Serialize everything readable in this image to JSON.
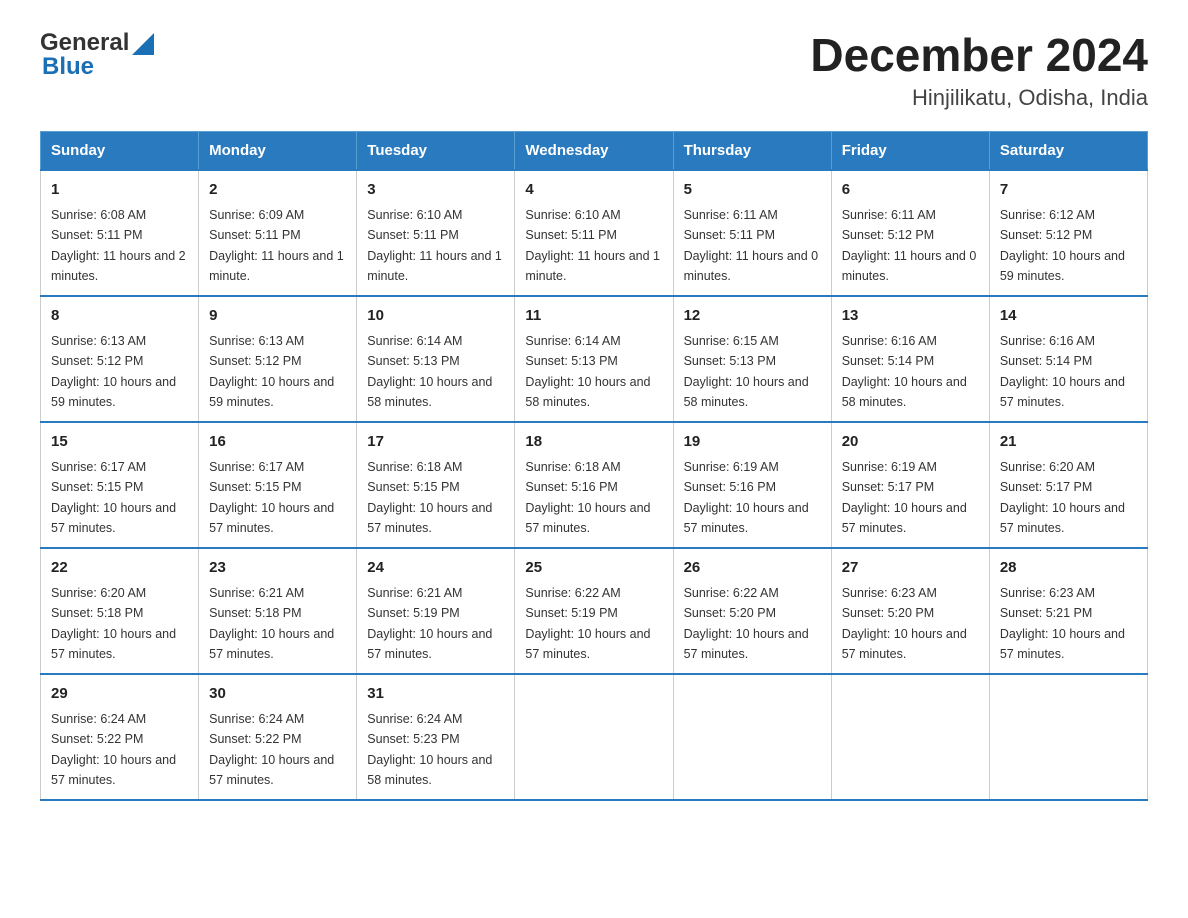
{
  "logo": {
    "text_general": "General",
    "text_blue": "Blue"
  },
  "header": {
    "month_year": "December 2024",
    "location": "Hinjilikatu, Odisha, India"
  },
  "weekdays": [
    "Sunday",
    "Monday",
    "Tuesday",
    "Wednesday",
    "Thursday",
    "Friday",
    "Saturday"
  ],
  "weeks": [
    [
      {
        "day": "1",
        "sunrise": "6:08 AM",
        "sunset": "5:11 PM",
        "daylight": "11 hours and 2 minutes."
      },
      {
        "day": "2",
        "sunrise": "6:09 AM",
        "sunset": "5:11 PM",
        "daylight": "11 hours and 1 minute."
      },
      {
        "day": "3",
        "sunrise": "6:10 AM",
        "sunset": "5:11 PM",
        "daylight": "11 hours and 1 minute."
      },
      {
        "day": "4",
        "sunrise": "6:10 AM",
        "sunset": "5:11 PM",
        "daylight": "11 hours and 1 minute."
      },
      {
        "day": "5",
        "sunrise": "6:11 AM",
        "sunset": "5:11 PM",
        "daylight": "11 hours and 0 minutes."
      },
      {
        "day": "6",
        "sunrise": "6:11 AM",
        "sunset": "5:12 PM",
        "daylight": "11 hours and 0 minutes."
      },
      {
        "day": "7",
        "sunrise": "6:12 AM",
        "sunset": "5:12 PM",
        "daylight": "10 hours and 59 minutes."
      }
    ],
    [
      {
        "day": "8",
        "sunrise": "6:13 AM",
        "sunset": "5:12 PM",
        "daylight": "10 hours and 59 minutes."
      },
      {
        "day": "9",
        "sunrise": "6:13 AM",
        "sunset": "5:12 PM",
        "daylight": "10 hours and 59 minutes."
      },
      {
        "day": "10",
        "sunrise": "6:14 AM",
        "sunset": "5:13 PM",
        "daylight": "10 hours and 58 minutes."
      },
      {
        "day": "11",
        "sunrise": "6:14 AM",
        "sunset": "5:13 PM",
        "daylight": "10 hours and 58 minutes."
      },
      {
        "day": "12",
        "sunrise": "6:15 AM",
        "sunset": "5:13 PM",
        "daylight": "10 hours and 58 minutes."
      },
      {
        "day": "13",
        "sunrise": "6:16 AM",
        "sunset": "5:14 PM",
        "daylight": "10 hours and 58 minutes."
      },
      {
        "day": "14",
        "sunrise": "6:16 AM",
        "sunset": "5:14 PM",
        "daylight": "10 hours and 57 minutes."
      }
    ],
    [
      {
        "day": "15",
        "sunrise": "6:17 AM",
        "sunset": "5:15 PM",
        "daylight": "10 hours and 57 minutes."
      },
      {
        "day": "16",
        "sunrise": "6:17 AM",
        "sunset": "5:15 PM",
        "daylight": "10 hours and 57 minutes."
      },
      {
        "day": "17",
        "sunrise": "6:18 AM",
        "sunset": "5:15 PM",
        "daylight": "10 hours and 57 minutes."
      },
      {
        "day": "18",
        "sunrise": "6:18 AM",
        "sunset": "5:16 PM",
        "daylight": "10 hours and 57 minutes."
      },
      {
        "day": "19",
        "sunrise": "6:19 AM",
        "sunset": "5:16 PM",
        "daylight": "10 hours and 57 minutes."
      },
      {
        "day": "20",
        "sunrise": "6:19 AM",
        "sunset": "5:17 PM",
        "daylight": "10 hours and 57 minutes."
      },
      {
        "day": "21",
        "sunrise": "6:20 AM",
        "sunset": "5:17 PM",
        "daylight": "10 hours and 57 minutes."
      }
    ],
    [
      {
        "day": "22",
        "sunrise": "6:20 AM",
        "sunset": "5:18 PM",
        "daylight": "10 hours and 57 minutes."
      },
      {
        "day": "23",
        "sunrise": "6:21 AM",
        "sunset": "5:18 PM",
        "daylight": "10 hours and 57 minutes."
      },
      {
        "day": "24",
        "sunrise": "6:21 AM",
        "sunset": "5:19 PM",
        "daylight": "10 hours and 57 minutes."
      },
      {
        "day": "25",
        "sunrise": "6:22 AM",
        "sunset": "5:19 PM",
        "daylight": "10 hours and 57 minutes."
      },
      {
        "day": "26",
        "sunrise": "6:22 AM",
        "sunset": "5:20 PM",
        "daylight": "10 hours and 57 minutes."
      },
      {
        "day": "27",
        "sunrise": "6:23 AM",
        "sunset": "5:20 PM",
        "daylight": "10 hours and 57 minutes."
      },
      {
        "day": "28",
        "sunrise": "6:23 AM",
        "sunset": "5:21 PM",
        "daylight": "10 hours and 57 minutes."
      }
    ],
    [
      {
        "day": "29",
        "sunrise": "6:24 AM",
        "sunset": "5:22 PM",
        "daylight": "10 hours and 57 minutes."
      },
      {
        "day": "30",
        "sunrise": "6:24 AM",
        "sunset": "5:22 PM",
        "daylight": "10 hours and 57 minutes."
      },
      {
        "day": "31",
        "sunrise": "6:24 AM",
        "sunset": "5:23 PM",
        "daylight": "10 hours and 58 minutes."
      },
      null,
      null,
      null,
      null
    ]
  ]
}
